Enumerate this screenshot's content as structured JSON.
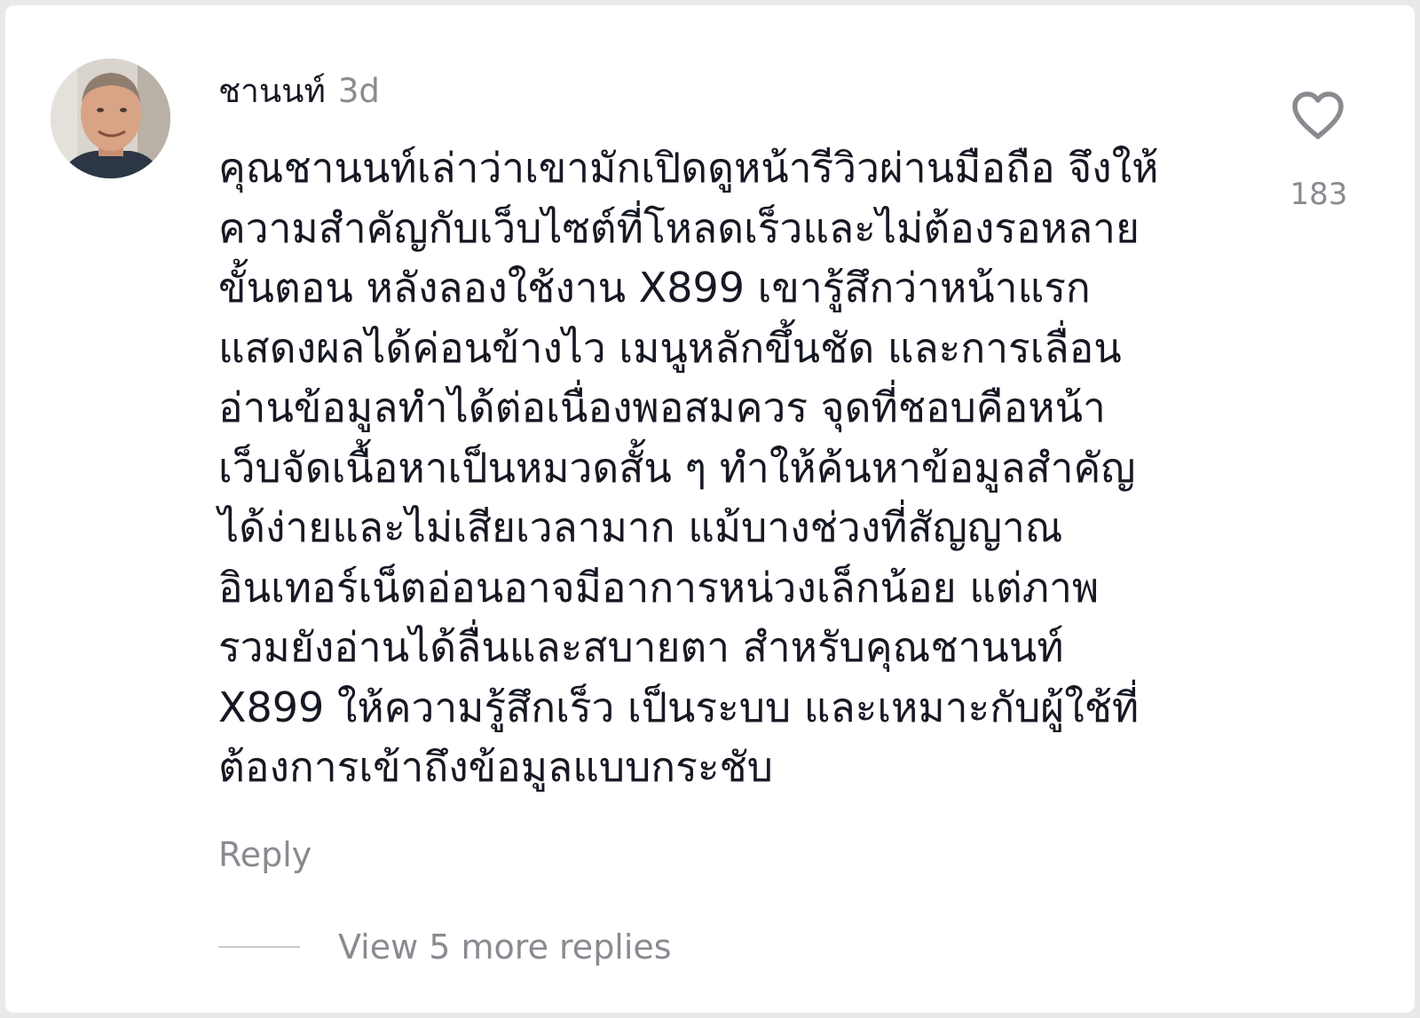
{
  "comment": {
    "username": "ชานนท์",
    "timestamp": "3d",
    "avatar_icon": "user-avatar-photo",
    "text": "คุณชานนท์เล่าว่าเขามักเปิดดูหน้ารีวิวผ่านมือถือ จึงให้\nความสำคัญกับเว็บไซต์ที่โหลดเร็วและไม่ต้องรอหลาย\nขั้นตอน หลังลองใช้งาน X899 เขารู้สึกว่าหน้าแรก\nแสดงผลได้ค่อนข้างไว เมนูหลักขึ้นชัด และการเลื่อน\nอ่านข้อมูลทำได้ต่อเนื่องพอสมควร จุดที่ชอบคือหน้า\nเว็บจัดเนื้อหาเป็นหมวดสั้น ๆ ทำให้ค้นหาข้อมูลสำคัญ\nได้ง่ายและไม่เสียเวลามาก แม้บางช่วงที่สัญญาณ\nอินเทอร์เน็ตอ่อนอาจมีอาการหน่วงเล็กน้อย แต่ภาพ\nรวมยังอ่านได้ลื่นและสบายตา สำหรับคุณชานนท์\nX899 ให้ความรู้สึกเร็ว เป็นระบบ และเหมาะกับผู้ใช้ที่\nต้องการเข้าถึงข้อมูลแบบกระชับ",
    "reply_label": "Reply",
    "view_replies_label": "View 5 more replies",
    "like_icon": "heart-outline-icon",
    "like_count": "183"
  },
  "colors": {
    "primary_text": "#161823",
    "secondary_text": "#8a8b91",
    "divider": "#c9cacd",
    "background": "#ffffff"
  }
}
